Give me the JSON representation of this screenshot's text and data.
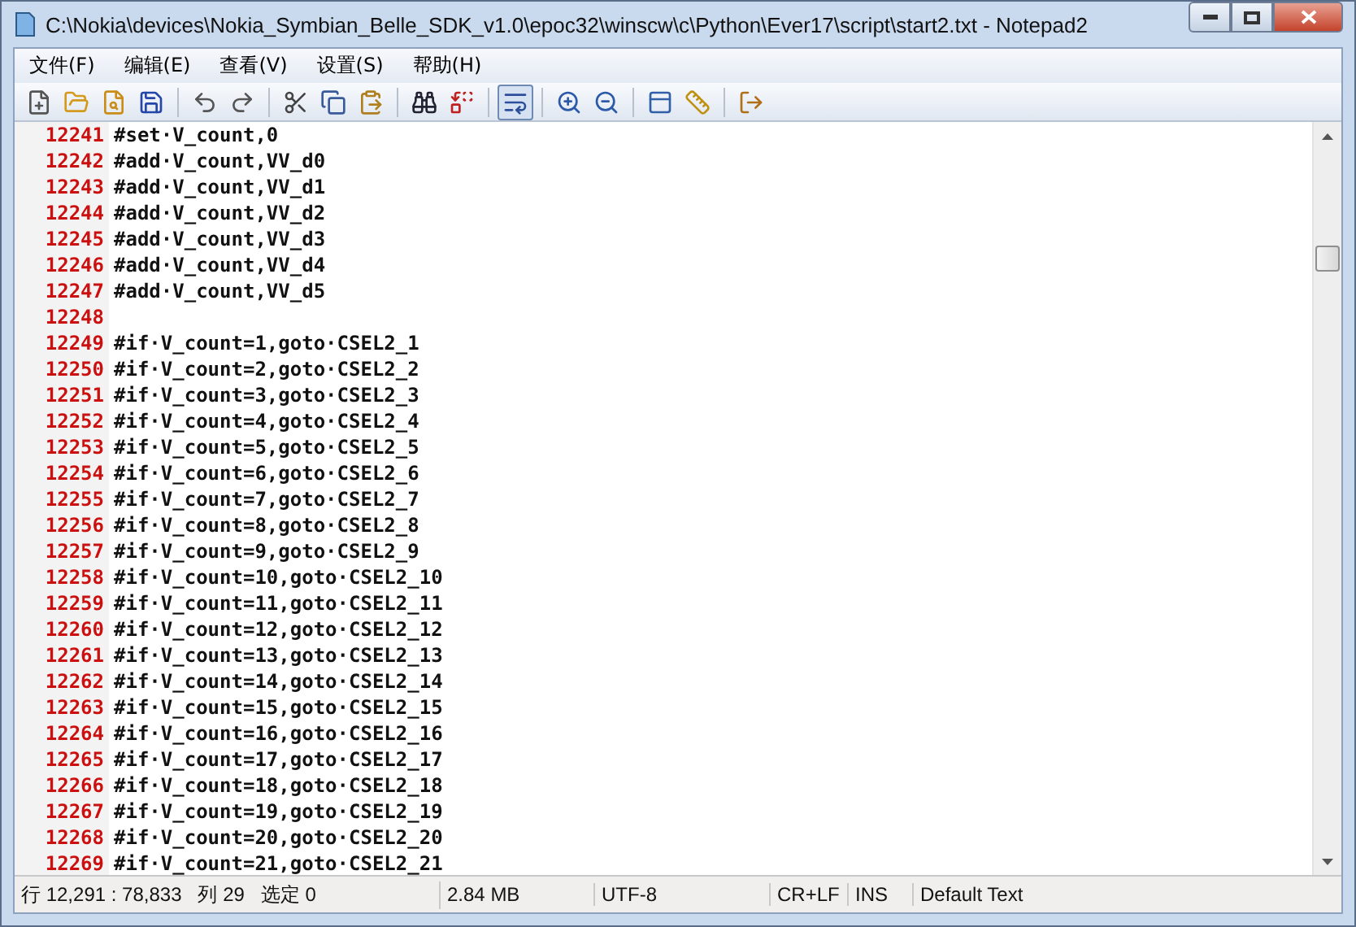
{
  "window": {
    "title": "C:\\Nokia\\devices\\Nokia_Symbian_Belle_SDK_v1.0\\epoc32\\winscw\\c\\Python\\Ever17\\script\\start2.txt - Notepad2"
  },
  "menu": [
    "文件(F)",
    "编辑(E)",
    "查看(V)",
    "设置(S)",
    "帮助(H)"
  ],
  "toolbar": [
    {
      "kind": "new",
      "pressed": false
    },
    {
      "kind": "open",
      "pressed": false
    },
    {
      "kind": "browse",
      "pressed": false
    },
    {
      "kind": "save",
      "pressed": false
    },
    {
      "kind": "separator"
    },
    {
      "kind": "undo",
      "pressed": false
    },
    {
      "kind": "redo",
      "pressed": false
    },
    {
      "kind": "separator"
    },
    {
      "kind": "cut",
      "pressed": false
    },
    {
      "kind": "copy",
      "pressed": false
    },
    {
      "kind": "paste",
      "pressed": false
    },
    {
      "kind": "separator"
    },
    {
      "kind": "find",
      "pressed": false
    },
    {
      "kind": "replace",
      "pressed": false
    },
    {
      "kind": "separator"
    },
    {
      "kind": "wrap",
      "pressed": true
    },
    {
      "kind": "separator"
    },
    {
      "kind": "zoom-in",
      "pressed": false
    },
    {
      "kind": "zoom-out",
      "pressed": false
    },
    {
      "kind": "separator"
    },
    {
      "kind": "view",
      "pressed": false
    },
    {
      "kind": "scheme",
      "pressed": false
    },
    {
      "kind": "separator"
    },
    {
      "kind": "exit",
      "pressed": false
    }
  ],
  "editor": {
    "lines": [
      {
        "number": "12241",
        "text": "#set·V_count,0"
      },
      {
        "number": "12242",
        "text": "#add·V_count,VV_d0"
      },
      {
        "number": "12243",
        "text": "#add·V_count,VV_d1"
      },
      {
        "number": "12244",
        "text": "#add·V_count,VV_d2"
      },
      {
        "number": "12245",
        "text": "#add·V_count,VV_d3"
      },
      {
        "number": "12246",
        "text": "#add·V_count,VV_d4"
      },
      {
        "number": "12247",
        "text": "#add·V_count,VV_d5"
      },
      {
        "number": "12248"
      },
      {
        "number": "12249",
        "text": "#if·V_count=1,goto·CSEL2_1"
      },
      {
        "number": "12250",
        "text": "#if·V_count=2,goto·CSEL2_2"
      },
      {
        "number": "12251",
        "text": "#if·V_count=3,goto·CSEL2_3"
      },
      {
        "number": "12252",
        "text": "#if·V_count=4,goto·CSEL2_4"
      },
      {
        "number": "12253",
        "text": "#if·V_count=5,goto·CSEL2_5"
      },
      {
        "number": "12254",
        "text": "#if·V_count=6,goto·CSEL2_6"
      },
      {
        "number": "12255",
        "text": "#if·V_count=7,goto·CSEL2_7"
      },
      {
        "number": "12256",
        "text": "#if·V_count=8,goto·CSEL2_8"
      },
      {
        "number": "12257",
        "text": "#if·V_count=9,goto·CSEL2_9"
      },
      {
        "number": "12258",
        "text": "#if·V_count=10,goto·CSEL2_10"
      },
      {
        "number": "12259",
        "text": "#if·V_count=11,goto·CSEL2_11"
      },
      {
        "number": "12260",
        "text": "#if·V_count=12,goto·CSEL2_12"
      },
      {
        "number": "12261",
        "text": "#if·V_count=13,goto·CSEL2_13"
      },
      {
        "number": "12262",
        "text": "#if·V_count=14,goto·CSEL2_14"
      },
      {
        "number": "12263",
        "text": "#if·V_count=15,goto·CSEL2_15"
      },
      {
        "number": "12264",
        "text": "#if·V_count=16,goto·CSEL2_16"
      },
      {
        "number": "12265",
        "text": "#if·V_count=17,goto·CSEL2_17"
      },
      {
        "number": "12266",
        "text": "#if·V_count=18,goto·CSEL2_18"
      },
      {
        "number": "12267",
        "text": "#if·V_count=19,goto·CSEL2_19"
      },
      {
        "number": "12268",
        "text": "#if·V_count=20,goto·CSEL2_20"
      },
      {
        "number": "12269",
        "text": "#if·V_count=21,goto·CSEL2_21"
      }
    ]
  },
  "status_bar": [
    "行 12,291 : 78,833   列 29   选定 0",
    "2.84 MB",
    "UTF-8",
    "CR+LF",
    "INS",
    "Default Text"
  ]
}
